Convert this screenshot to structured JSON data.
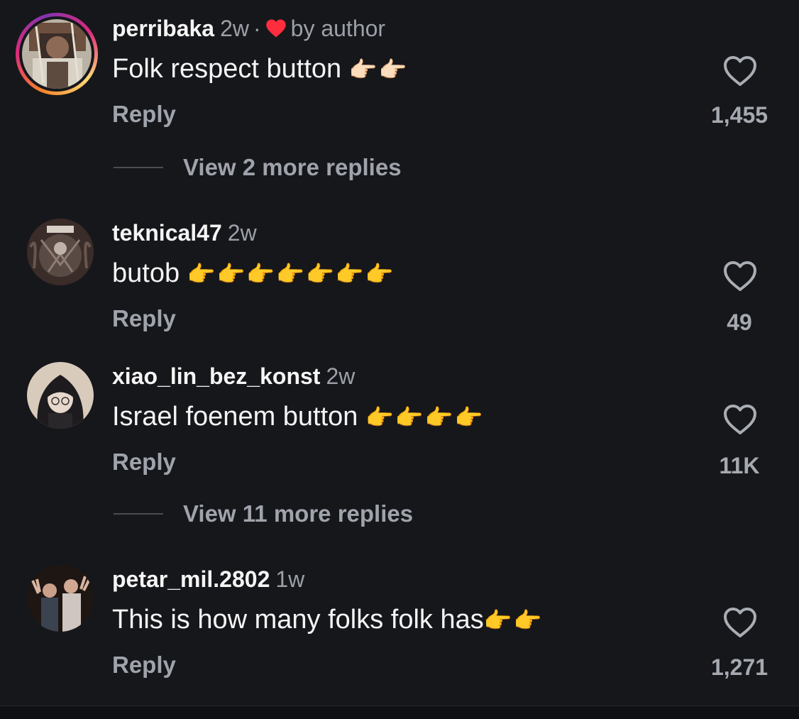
{
  "comments": [
    {
      "username": "perribaka",
      "time": "2w",
      "separator": "·",
      "liked_by": "by author",
      "text": "Folk respect button ",
      "emoji": "👉🏻👉🏻",
      "reply_label": "Reply",
      "likes": "1,455",
      "view_more": "View 2 more replies"
    },
    {
      "username": "teknical47",
      "time": "2w",
      "text": "butob ",
      "emoji": "👉👉👉👉👉👉👉",
      "reply_label": "Reply",
      "likes": "49"
    },
    {
      "username": "xiao_lin_bez_konst",
      "time": "2w",
      "text": "Israel foenem button ",
      "emoji": "👉👉👉👉",
      "reply_label": "Reply",
      "likes": "11K",
      "view_more": "View 11 more replies"
    },
    {
      "username": "petar_mil.2802",
      "time": "1w",
      "text": "This is how many folks folk has",
      "emoji": "👉👉",
      "reply_label": "Reply",
      "likes": "1,271"
    }
  ],
  "colors": {
    "background": "#16171b",
    "secondary_text": "#9ca0a8",
    "author_heart": "#ff2d3d",
    "emoji_yellow": "#f7c948"
  },
  "icons": {
    "like": "heart-outline-icon",
    "author_like": "heart-filled-icon"
  }
}
